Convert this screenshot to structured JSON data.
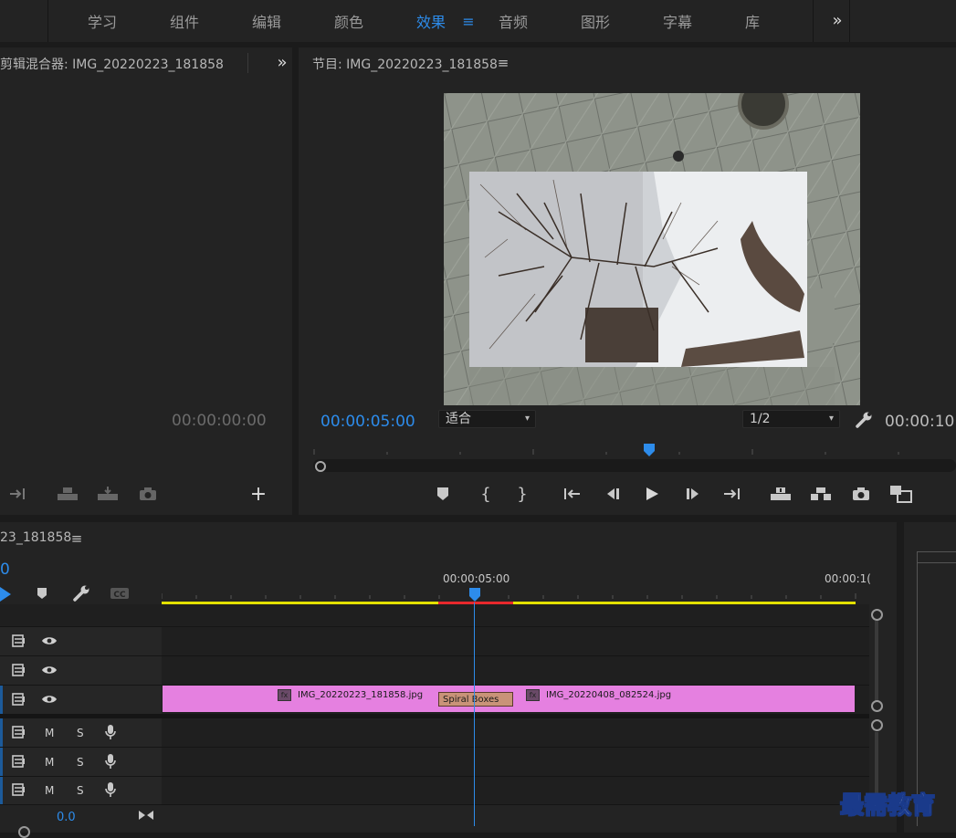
{
  "workspace_tabs": [
    "学习",
    "组件",
    "编辑",
    "颜色",
    "效果",
    "音频",
    "图形",
    "字幕",
    "库"
  ],
  "active_tab": "效果",
  "mixer": {
    "title": "剪辑混合器: IMG_20220223_181858",
    "timecode": "00:00:00:00"
  },
  "program": {
    "title": "节目: IMG_20220223_181858",
    "timecode": "00:00:05:00",
    "fit_label": "适合",
    "resolution": "1/2",
    "end_timecode": "00:00:10:"
  },
  "timeline": {
    "title": "23_181858",
    "playhead_time": "0",
    "ruler_label_mid": "00:00:05:00",
    "ruler_label_end": "00:00:1(",
    "clip1": "IMG_20220223_181858.jpg",
    "transition": "Spiral Boxes",
    "clip2": "IMG_20220408_082524.jpg",
    "audio_mute": "M",
    "audio_solo": "S",
    "volume": "0.0",
    "fx_badge": "fx"
  },
  "watermark": "最需教育",
  "colors": {
    "accent": "#2d8ceb",
    "clip": "#e580e0",
    "transition": "#c99378",
    "work_area": "#e3e000",
    "render_red": "#e8282c"
  }
}
